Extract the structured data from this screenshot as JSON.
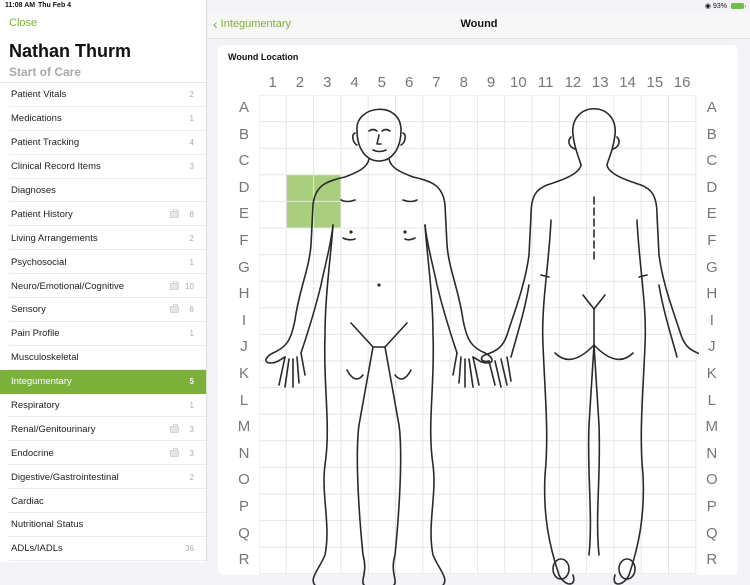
{
  "status_bar": {
    "time": "11:08 AM",
    "date": "Thu Feb 4",
    "wifi_icon": "wifi-icon",
    "battery": "93%",
    "battery_icon": "battery-charging-icon"
  },
  "sidebar": {
    "close_label": "Close",
    "patient_name": "Nathan Thurm",
    "subtitle": "Start of Care",
    "items": [
      {
        "label": "Patient Vitals",
        "count": "2",
        "kit": false,
        "selected": false
      },
      {
        "label": "Medications",
        "count": "1",
        "kit": false,
        "selected": false
      },
      {
        "label": "Patient Tracking",
        "count": "4",
        "kit": false,
        "selected": false
      },
      {
        "label": "Clinical Record Items",
        "count": "3",
        "kit": false,
        "selected": false
      },
      {
        "label": "Diagnoses",
        "count": "",
        "kit": false,
        "selected": false
      },
      {
        "label": "Patient History",
        "count": "8",
        "kit": true,
        "selected": false
      },
      {
        "label": "Living Arrangements",
        "count": "2",
        "kit": false,
        "selected": false
      },
      {
        "label": "Psychosocial",
        "count": "1",
        "kit": false,
        "selected": false
      },
      {
        "label": "Neuro/Emotional/Cognitive",
        "count": "10",
        "kit": true,
        "selected": false
      },
      {
        "label": "Sensory",
        "count": "6",
        "kit": true,
        "selected": false
      },
      {
        "label": "Pain Profile",
        "count": "1",
        "kit": false,
        "selected": false
      },
      {
        "label": "Musculoskeletal",
        "count": "",
        "kit": false,
        "selected": false
      },
      {
        "label": "Integumentary",
        "count": "5",
        "kit": false,
        "selected": true
      },
      {
        "label": "Respiratory",
        "count": "1",
        "kit": false,
        "selected": false
      },
      {
        "label": "Renal/Genitourinary",
        "count": "3",
        "kit": true,
        "selected": false
      },
      {
        "label": "Endocrine",
        "count": "3",
        "kit": true,
        "selected": false
      },
      {
        "label": "Digestive/Gastrointestinal",
        "count": "2",
        "kit": false,
        "selected": false
      },
      {
        "label": "Cardiac",
        "count": "",
        "kit": false,
        "selected": false
      },
      {
        "label": "Nutritional Status",
        "count": "",
        "kit": false,
        "selected": false
      },
      {
        "label": "ADLs/IADLs",
        "count": "36",
        "kit": false,
        "selected": false
      }
    ]
  },
  "navbar": {
    "back_label": "Integumentary",
    "title": "Wound"
  },
  "wound_location": {
    "title": "Wound Location",
    "columns": [
      "1",
      "2",
      "3",
      "4",
      "5",
      "6",
      "7",
      "8",
      "9",
      "10",
      "11",
      "12",
      "13",
      "14",
      "15",
      "16"
    ],
    "rows": [
      "A",
      "B",
      "C",
      "D",
      "E",
      "F",
      "G",
      "H",
      "I",
      "J",
      "K",
      "L",
      "M",
      "N",
      "O",
      "P",
      "Q",
      "R"
    ],
    "selected_cells": [
      {
        "row": "D",
        "col": "2"
      },
      {
        "row": "D",
        "col": "3"
      },
      {
        "row": "E",
        "col": "2"
      },
      {
        "row": "E",
        "col": "3"
      }
    ],
    "highlight_color": "#a9cf7e",
    "figures": [
      "body-front",
      "body-back"
    ]
  }
}
